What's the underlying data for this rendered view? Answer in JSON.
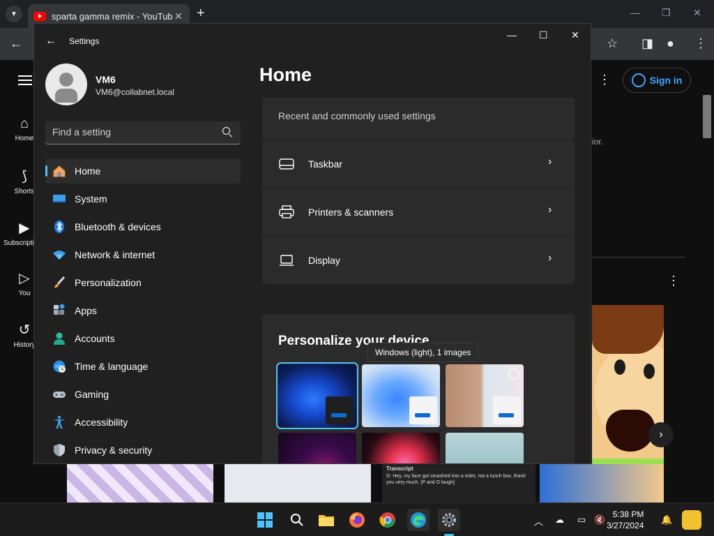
{
  "browser": {
    "tab_title": "sparta gamma remix - YouTube",
    "tab_close": "✕",
    "new_tab": "+",
    "minimize": "—",
    "restore": "❐",
    "close": "✕"
  },
  "youtube": {
    "nav": [
      {
        "label": "Home",
        "icon": "home-icon",
        "glyph": "⌂"
      },
      {
        "label": "Shorts",
        "icon": "shorts-icon",
        "glyph": "⟆"
      },
      {
        "label": "Subscriptions",
        "icon": "subscriptions-icon",
        "glyph": "▶"
      },
      {
        "label": "You",
        "icon": "you-icon",
        "glyph": "▷"
      },
      {
        "label": "History",
        "icon": "history-icon",
        "glyph": "↺"
      }
    ],
    "signin_label": "Sign in",
    "hint_text": "ior.",
    "transcript_title": "Transcript",
    "transcript_text": "G: Hey, my face got smashed into a toilet, not a lunch box, thank you very much. [P and O laugh]"
  },
  "settings": {
    "window_title": "Settings",
    "user": {
      "name": "VM6",
      "email": "VM6@collabnet.local"
    },
    "search_placeholder": "Find a setting",
    "nav": [
      {
        "label": "Home",
        "active": true,
        "icon": "home-icon"
      },
      {
        "label": "System",
        "icon": "system-icon"
      },
      {
        "label": "Bluetooth & devices",
        "icon": "bluetooth-icon"
      },
      {
        "label": "Network & internet",
        "icon": "network-icon"
      },
      {
        "label": "Personalization",
        "icon": "brush-icon"
      },
      {
        "label": "Apps",
        "icon": "apps-icon"
      },
      {
        "label": "Accounts",
        "icon": "accounts-icon"
      },
      {
        "label": "Time & language",
        "icon": "time-language-icon"
      },
      {
        "label": "Gaming",
        "icon": "gaming-icon"
      },
      {
        "label": "Accessibility",
        "icon": "accessibility-icon"
      },
      {
        "label": "Privacy & security",
        "icon": "shield-icon"
      }
    ],
    "page_title": "Home",
    "recommended_subtitle": "Recent and commonly used settings",
    "recommended": [
      {
        "label": "Taskbar",
        "icon": "taskbar-icon"
      },
      {
        "label": "Printers & scanners",
        "icon": "printer-icon"
      },
      {
        "label": "Display",
        "icon": "display-icon"
      }
    ],
    "personalize_title": "Personalize your device",
    "theme_tooltip": "Windows (light), 1 images"
  },
  "taskbar": {
    "time": "5:38 PM",
    "date": "3/27/2024"
  },
  "colors": {
    "accent": "#4cc2ff",
    "settings_bg": "#202020",
    "card_bg": "#2b2b2b",
    "youtube_red": "#ff0000",
    "signin_blue": "#3ea6ff"
  }
}
